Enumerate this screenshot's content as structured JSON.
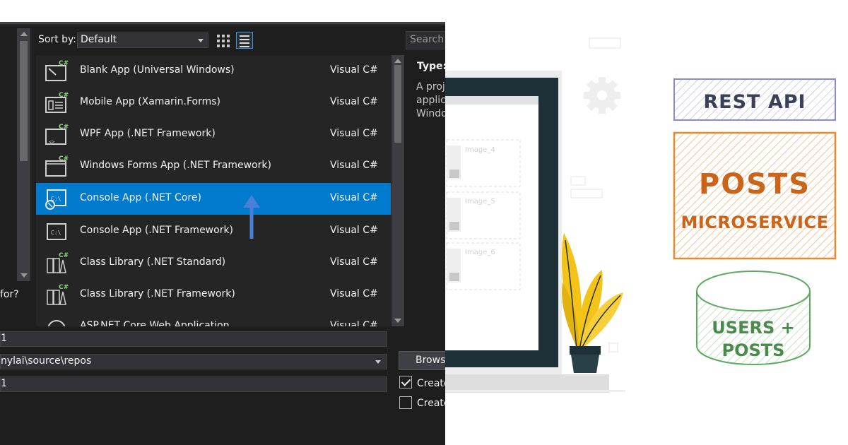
{
  "dialog": {
    "sort_label": "Sort by:",
    "sort_value": "Default",
    "search_placeholder": "Search (",
    "type_label": "Type:",
    "description_lines": [
      "A proje",
      "applica",
      "Windo"
    ],
    "side_question": "for?",
    "templates": [
      {
        "name": "Blank App (Universal Windows)",
        "language": "Visual C#",
        "icon": "blank-app-icon"
      },
      {
        "name": "Mobile App (Xamarin.Forms)",
        "language": "Visual C#",
        "icon": "mobile-app-icon"
      },
      {
        "name": "WPF App (.NET Framework)",
        "language": "Visual C#",
        "icon": "wpf-app-icon"
      },
      {
        "name": "Windows Forms App (.NET Framework)",
        "language": "Visual C#",
        "icon": "windows-forms-icon"
      },
      {
        "name": "Console App (.NET Core)",
        "language": "Visual C#",
        "icon": "console-app-icon",
        "selected": true
      },
      {
        "name": "Console App (.NET Framework)",
        "language": "Visual C#",
        "icon": "console-app-framework-icon"
      },
      {
        "name": "Class Library (.NET Standard)",
        "language": "Visual C#",
        "icon": "class-library-icon"
      },
      {
        "name": "Class Library (.NET Framework)",
        "language": "Visual C#",
        "icon": "class-library-framework-icon"
      },
      {
        "name": "ASP.NET Core Web Application",
        "language": "Visual C#",
        "icon": "web-app-icon"
      }
    ],
    "name_value": "1",
    "location_value": "nylai\\source\\repos",
    "solution_value": "1",
    "browse_label": "Browse",
    "create_dir_label": "Create",
    "create_dir_checked": true,
    "create_repo_label": "Create",
    "create_repo_checked": false,
    "accent_color": "#007acc",
    "annotation_arrow_color": "#4a7fd6"
  },
  "illustration": {
    "placeholders": [
      "Image_4",
      "Image_5",
      "Image_6"
    ],
    "icon": "gear-icon",
    "plant_color": "#f4c318",
    "frame_color": "#1e3038"
  },
  "diagram": {
    "top_box": "REST API",
    "middle_box_line1": "POSTS",
    "middle_box_line2": "MICROSERVICE",
    "database_line1": "USERS +",
    "database_line2": "POSTS",
    "colors": {
      "top": "#8a8bd6",
      "middle": "#e58b2f",
      "database": "#5fa860"
    }
  }
}
